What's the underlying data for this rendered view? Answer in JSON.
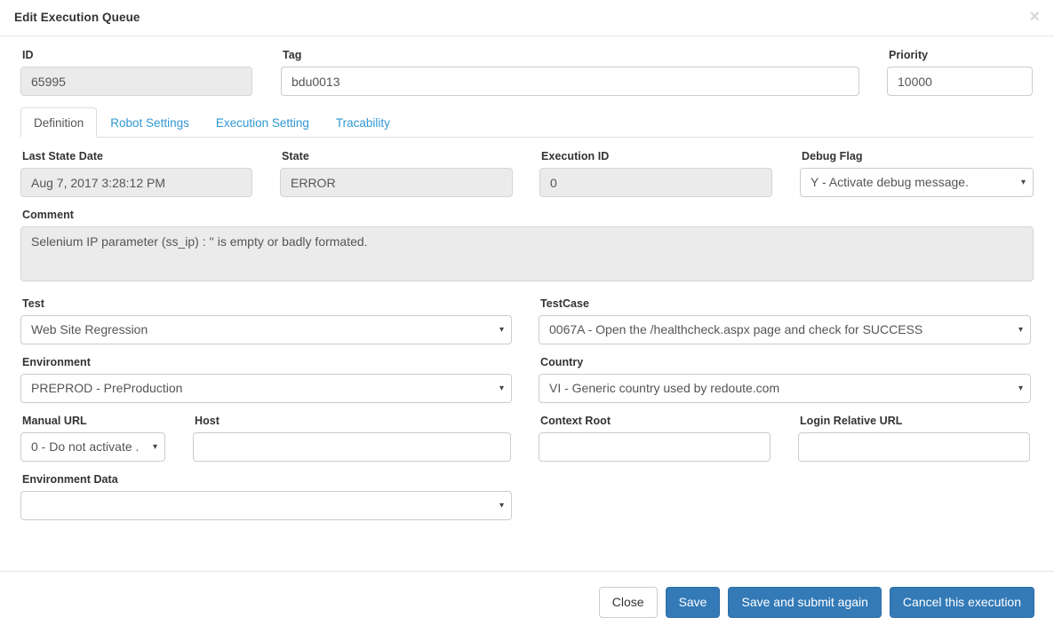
{
  "header": {
    "title": "Edit Execution Queue",
    "close_label": "×"
  },
  "top_fields": {
    "id": {
      "label": "ID",
      "value": "65995"
    },
    "tag": {
      "label": "Tag",
      "value": "bdu0013"
    },
    "priority": {
      "label": "Priority",
      "value": "10000"
    }
  },
  "tabs": [
    {
      "label": "Definition",
      "active": true
    },
    {
      "label": "Robot Settings",
      "active": false
    },
    {
      "label": "Execution Setting",
      "active": false
    },
    {
      "label": "Tracability",
      "active": false
    }
  ],
  "definition": {
    "last_state_date": {
      "label": "Last State Date",
      "value": "Aug 7, 2017 3:28:12 PM"
    },
    "state": {
      "label": "State",
      "value": "ERROR"
    },
    "execution_id": {
      "label": "Execution ID",
      "value": "0"
    },
    "debug_flag": {
      "label": "Debug Flag",
      "value": "Y - Activate debug message."
    },
    "comment": {
      "label": "Comment",
      "value": "Selenium IP parameter (ss_ip) : '' is empty or badly formated."
    },
    "test": {
      "label": "Test",
      "value": "Web Site Regression"
    },
    "testcase": {
      "label": "TestCase",
      "value": "0067A - Open the /healthcheck.aspx page and check for SUCCESS"
    },
    "environment": {
      "label": "Environment",
      "value": "PREPROD - PreProduction"
    },
    "country": {
      "label": "Country",
      "value": "VI - Generic country used by redoute.com"
    },
    "manual_url": {
      "label": "Manual URL",
      "value": "0 - Do not activate ."
    },
    "host": {
      "label": "Host",
      "value": ""
    },
    "context_root": {
      "label": "Context Root",
      "value": ""
    },
    "login_relative_url": {
      "label": "Login Relative URL",
      "value": ""
    },
    "environment_data": {
      "label": "Environment Data",
      "value": ""
    }
  },
  "footer": {
    "close": "Close",
    "save": "Save",
    "save_submit": "Save and submit again",
    "cancel_execution": "Cancel this execution"
  },
  "icons": {
    "caret_down": "▾"
  },
  "colors": {
    "primary_button": "#337ab7",
    "tab_link": "#3097d1",
    "readonly_field": "#ebebeb",
    "border": "#cccccc"
  }
}
